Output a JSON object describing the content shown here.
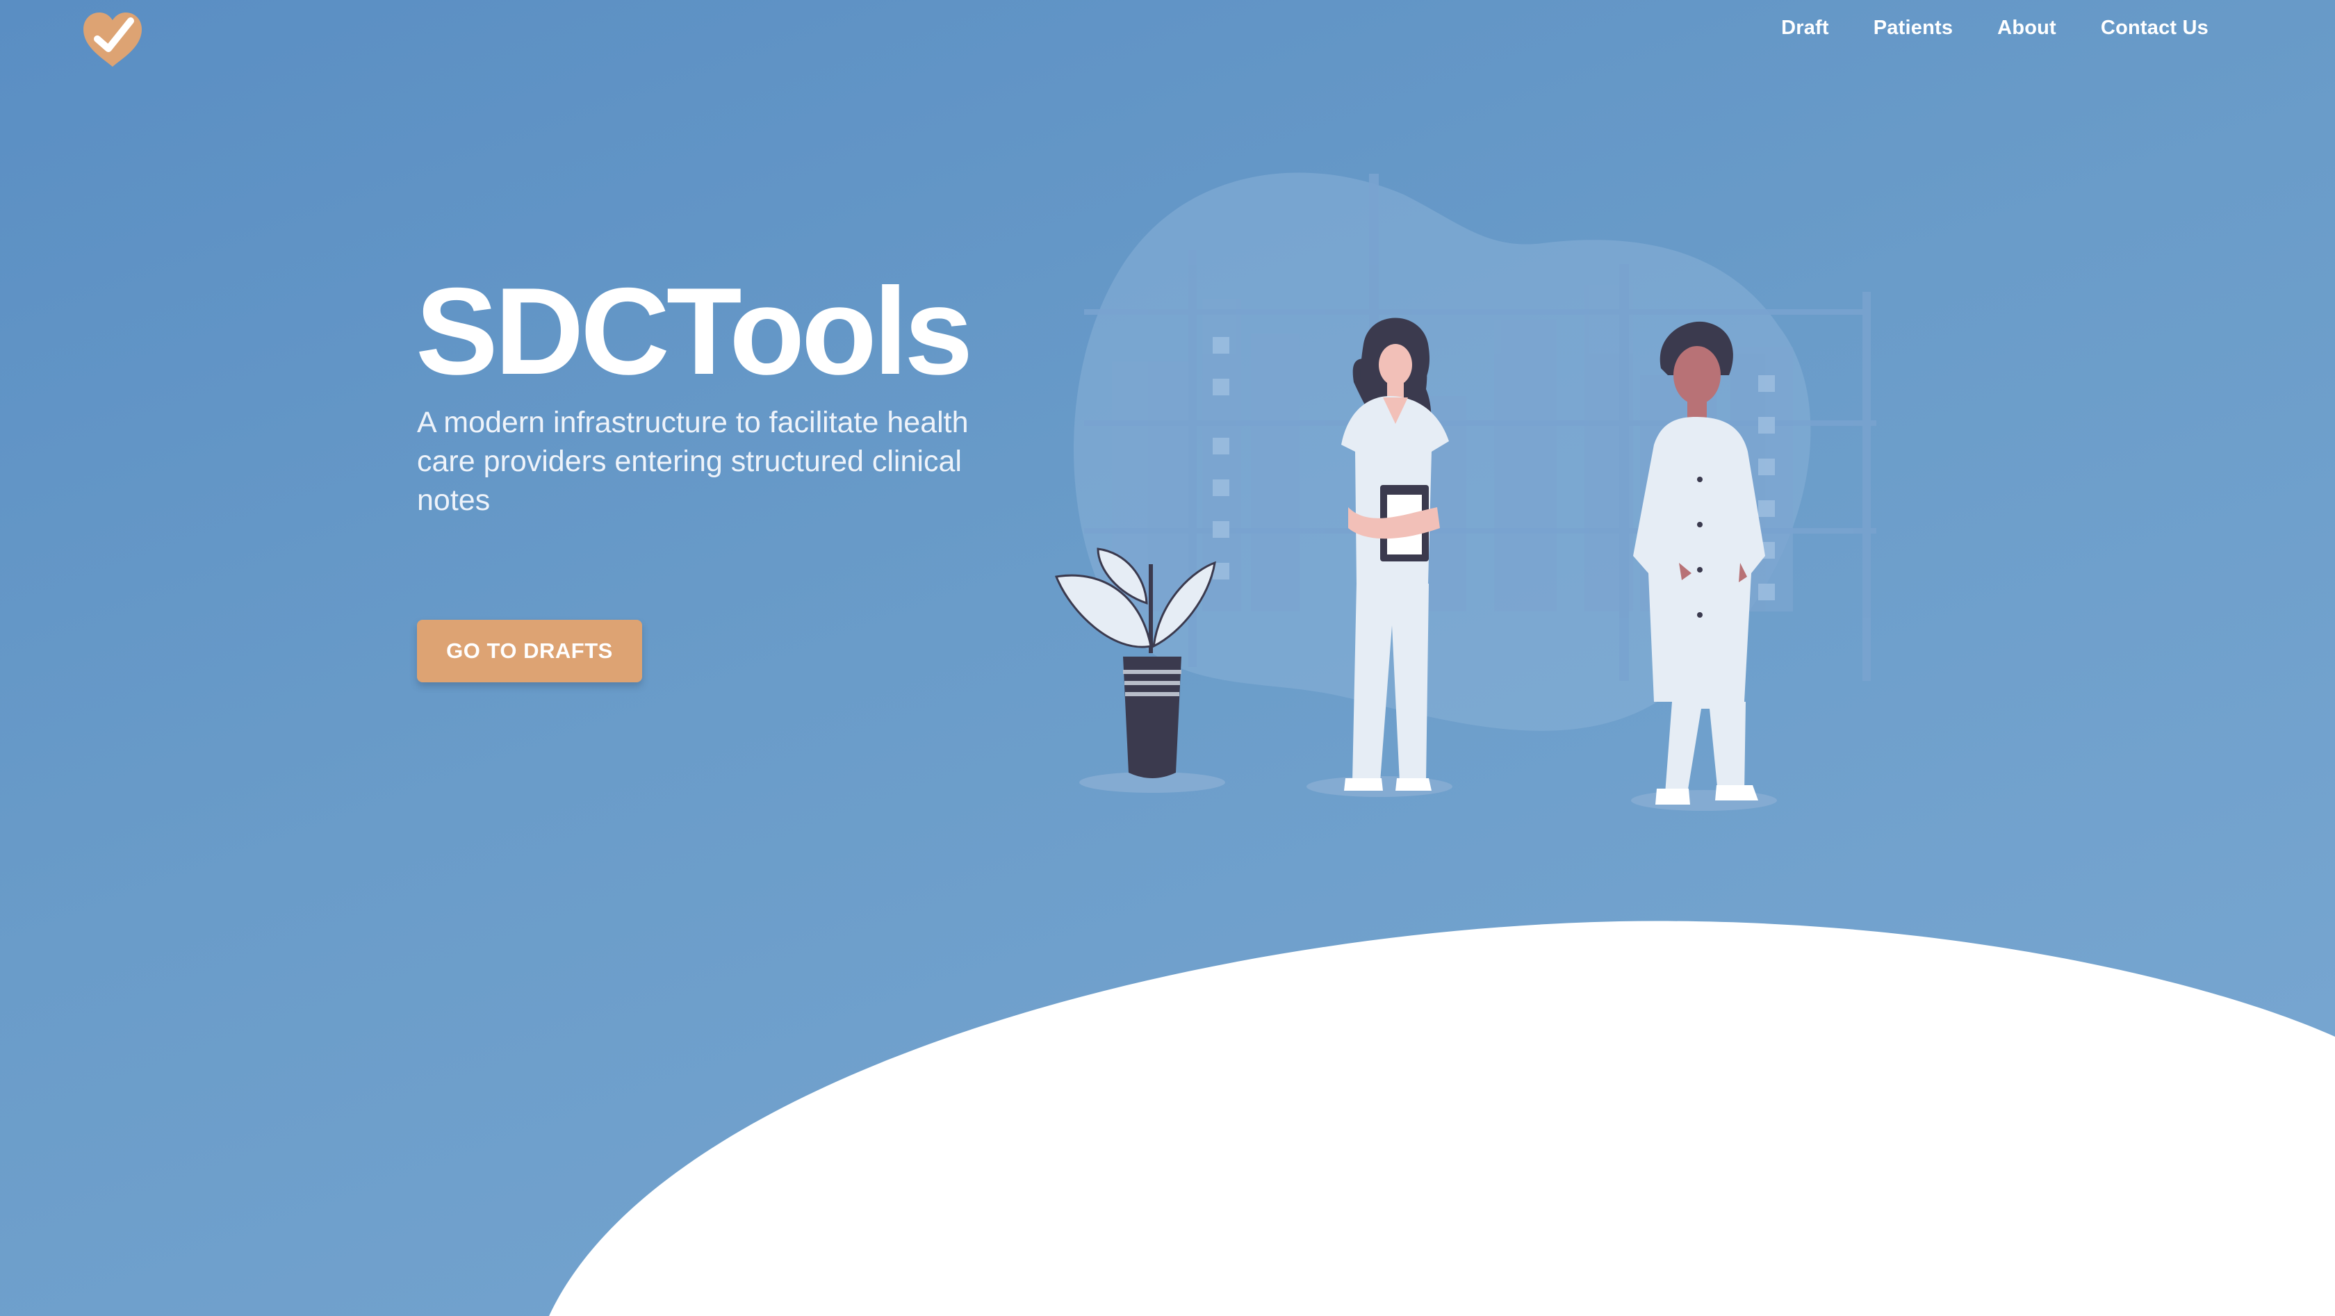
{
  "nav": {
    "items": [
      "Draft",
      "Patients",
      "About",
      "Contact Us"
    ]
  },
  "hero": {
    "title": "SDCTools",
    "subtitle": "A modern infrastructure to facilitate health care providers entering structured clinical notes",
    "cta_label": "GO TO DRAFTS"
  },
  "icons": {
    "logo": "heart-check-icon",
    "illustration": "doctors-illustration"
  },
  "colors": {
    "background": "#6499c9",
    "accent": "#dda373",
    "wave": "#ffffff",
    "text": "#ffffff"
  }
}
